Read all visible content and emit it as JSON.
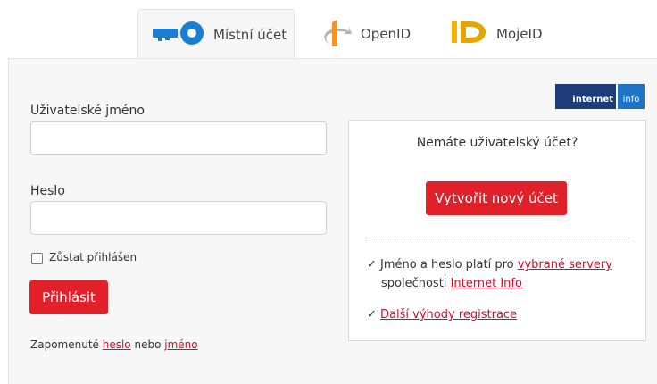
{
  "tabs": {
    "local": {
      "label": "Místní účet",
      "icon": "key-icon"
    },
    "openid": {
      "label": "OpenID",
      "icon": "openid-icon"
    },
    "mojeid": {
      "label": "MojeID",
      "icon": "mojeid-icon"
    }
  },
  "form": {
    "username_label": "Uživatelské jméno",
    "username_value": "",
    "password_label": "Heslo",
    "password_value": "",
    "remember_label": "Zůstat přihlášen",
    "remember_checked": false,
    "login_button": "Přihlásit",
    "forgot_prefix": "Zapomenuté",
    "forgot_password_link": "heslo",
    "forgot_or": "nebo",
    "forgot_name_link": "jméno"
  },
  "logo": {
    "part1": "internet",
    "part2": "info"
  },
  "signup": {
    "question": "Nemáte uživatelský účet?",
    "create_button": "Vytvořit nový účet",
    "check1_text1": "Jméno a heslo platí pro",
    "check1_link1": "vybrané servery",
    "check1_text2": "společnosti",
    "check1_link2": "Internet Info",
    "check2_link": "Další výhody registrace"
  },
  "colors": {
    "accent": "#e2202a",
    "link": "#c8102e",
    "key_icon": "#1a7fd4"
  }
}
